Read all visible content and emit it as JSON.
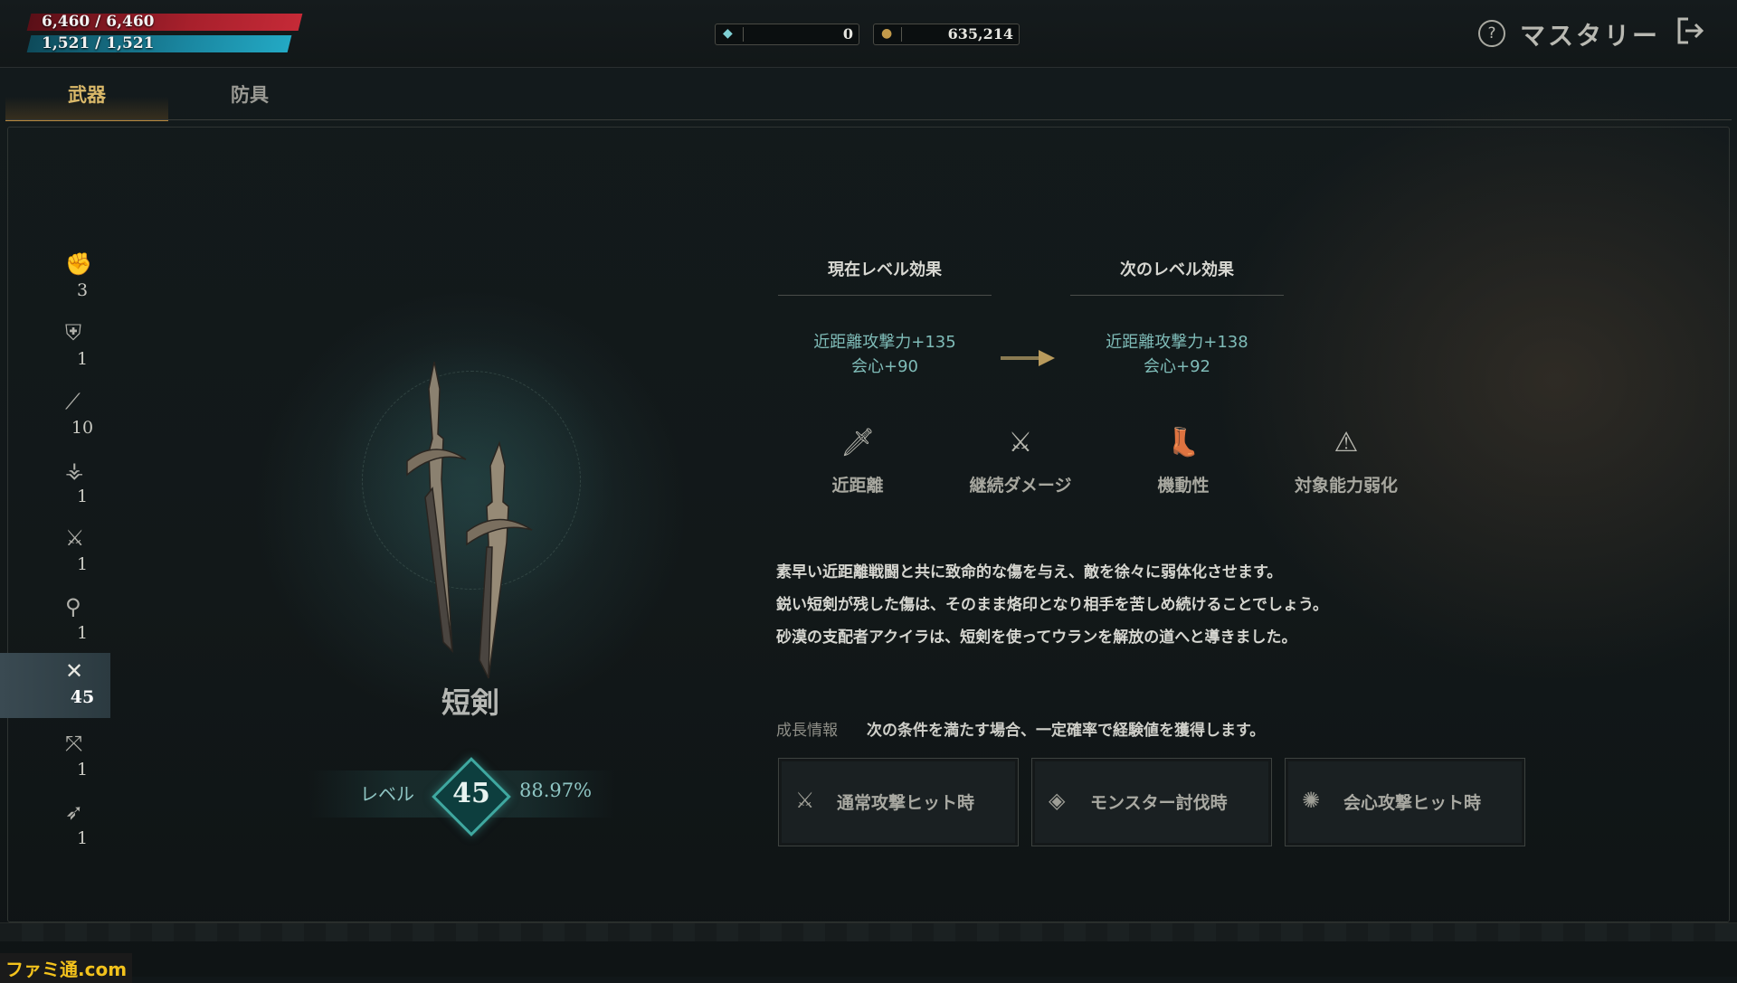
{
  "stats": {
    "hp": "6,460 / 6,460",
    "mp": "1,521 / 1,521"
  },
  "currency": [
    {
      "icon": "gem-icon",
      "value": "0"
    },
    {
      "icon": "gold-coin-icon",
      "value": "635,214"
    }
  ],
  "header": {
    "title": "マスタリー",
    "help": "?"
  },
  "tabs": [
    {
      "label": "武器"
    },
    {
      "label": "防具"
    }
  ],
  "weapon_list": [
    {
      "icon": "gauntlet-icon",
      "count": "3"
    },
    {
      "icon": "shield-icon",
      "count": "1"
    },
    {
      "icon": "staff-icon",
      "count": "10"
    },
    {
      "icon": "claw-icon",
      "count": "1"
    },
    {
      "icon": "sword-icon",
      "count": "1"
    },
    {
      "icon": "wand-icon",
      "count": "1"
    },
    {
      "icon": "dagger-icon",
      "count": "45",
      "selected": true
    },
    {
      "icon": "crossbow-icon",
      "count": "1"
    },
    {
      "icon": "bow-icon",
      "count": "1"
    }
  ],
  "weapon": {
    "name": "短剣",
    "level_label": "レベル",
    "level": "45",
    "progress": "88.97%"
  },
  "effects": {
    "current_header": "現在レベル効果",
    "next_header": "次のレベル効果",
    "current": [
      "近距離攻撃力+135",
      "会心+90"
    ],
    "next": [
      "近距離攻撃力+138",
      "会心+92"
    ]
  },
  "attributes": [
    {
      "icon": "melee-icon",
      "label": "近距離"
    },
    {
      "icon": "bleed-icon",
      "label": "継続ダメージ"
    },
    {
      "icon": "mobility-icon",
      "label": "機動性"
    },
    {
      "icon": "debuff-icon",
      "label": "対象能力弱化"
    }
  ],
  "description": [
    "素早い近距離戦闘と共に致命的な傷を与え、敵を徐々に弱体化させます。",
    "鋭い短剣が残した傷は、そのまま烙印となり相手を苦しめ続けることでしょう。",
    "砂漠の支配者アクイラは、短剣を使ってウランを解放の道へと導きました。"
  ],
  "growth": {
    "label": "成長情報",
    "text": "次の条件を満たす場合、一定確率で経験値を獲得します。",
    "conditions": [
      {
        "icon": "normal-attack-icon",
        "label": "通常攻撃ヒット時"
      },
      {
        "icon": "monster-kill-icon",
        "label": "モンスター討伐時"
      },
      {
        "icon": "critical-hit-icon",
        "label": "会心攻撃ヒット時"
      }
    ]
  },
  "watermark": "ファミ通.com",
  "colors": {
    "hp": "#a8202c",
    "mp": "#1a86a0",
    "accent": "#d9b869",
    "teal": "#3fa8a0"
  }
}
